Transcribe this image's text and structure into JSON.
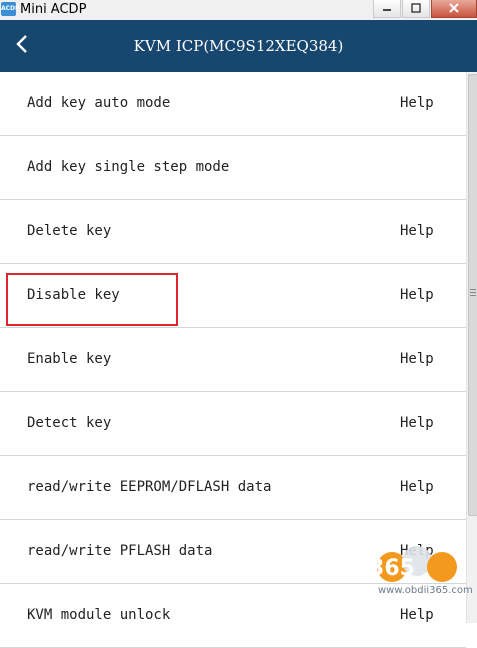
{
  "window": {
    "app_icon_text": "ACDP",
    "title": "Mini ACDP",
    "minimize_icon": "minimize-icon",
    "maximize_icon": "maximize-icon",
    "close_icon": "close-icon"
  },
  "header": {
    "back_icon": "chevron-left-icon",
    "title": "KVM ICP(MC9S12XEQ384)",
    "background": "#17466e"
  },
  "menu": {
    "items": [
      {
        "label": "Add key auto mode",
        "help": "Help"
      },
      {
        "label": "Add key single step mode",
        "help": ""
      },
      {
        "label": "Delete key",
        "help": "Help"
      },
      {
        "label": "Disable key",
        "help": "Help",
        "highlighted": true
      },
      {
        "label": "Enable key",
        "help": "Help"
      },
      {
        "label": "Detect key",
        "help": "Help"
      },
      {
        "label": "read/write EEPROM/DFLASH data",
        "help": "Help"
      },
      {
        "label": "read/write PFLASH data",
        "help": "Help"
      },
      {
        "label": "KVM module unlock",
        "help": "Help"
      }
    ],
    "highlight_color": "#e0262d"
  },
  "watermark": {
    "logo_text": "365",
    "url": "www.obdii365.com"
  }
}
